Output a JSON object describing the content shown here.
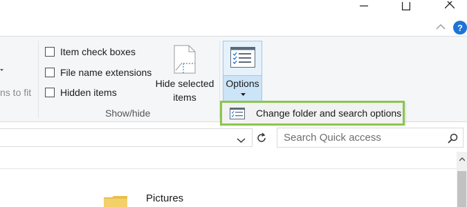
{
  "window": {
    "minimize_icon": "minimize-icon",
    "maximize_icon": "maximize-icon",
    "close_icon": "close-icon",
    "collapse_ribbon_icon": "chevron-up-icon",
    "help_label": "?",
    "help_color": "#1e73d6"
  },
  "ribbon": {
    "partial_label": "ns to fit",
    "checkboxes": [
      {
        "label": "Item check boxes",
        "checked": false
      },
      {
        "label": "File name extensions",
        "checked": false
      },
      {
        "label": "Hidden items",
        "checked": false
      }
    ],
    "hide_selected_label_line1": "Hide selected",
    "hide_selected_label_line2": "items",
    "options_label": "Options",
    "group_label": "Show/hide"
  },
  "options_menu": {
    "item_label": "Change folder and search options",
    "item_icon": "folder-options-icon",
    "highlight_color": "#8ac64b"
  },
  "address_bar": {
    "value": "",
    "dropdown_icon": "chevron-down-icon",
    "refresh_icon": "refresh-icon"
  },
  "search": {
    "placeholder": "Search Quick access",
    "icon": "search-icon"
  },
  "content": {
    "items": [
      {
        "name": "Pictures",
        "icon": "folder-icon"
      }
    ]
  }
}
